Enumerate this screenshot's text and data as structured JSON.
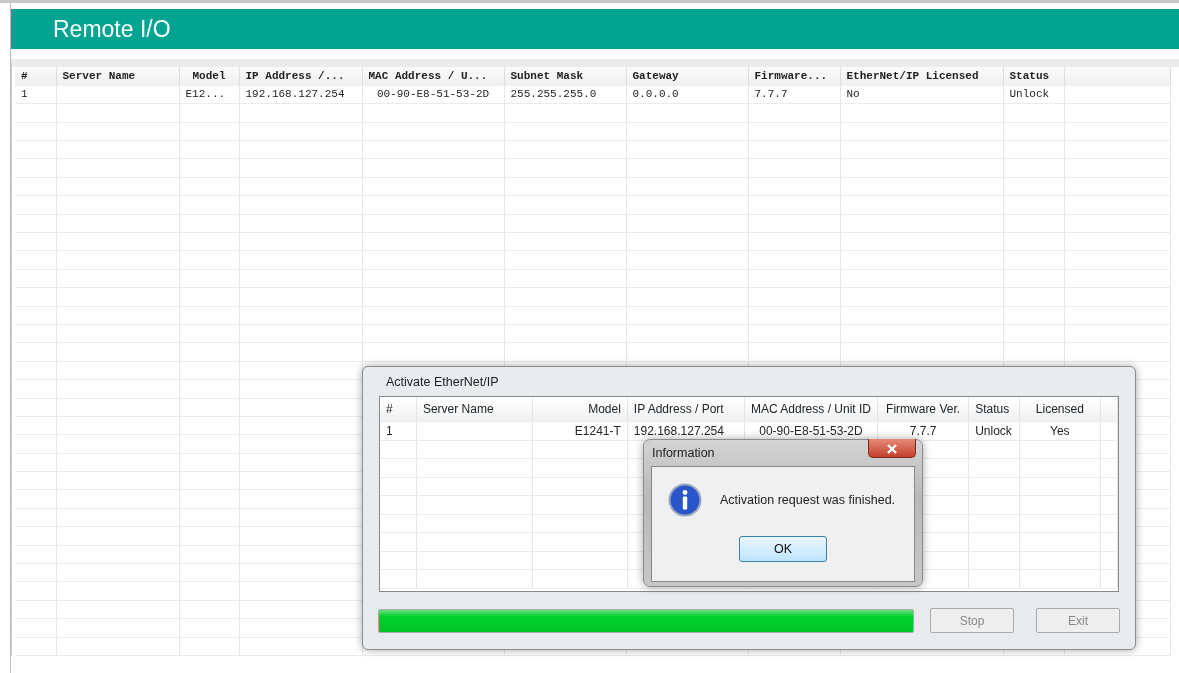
{
  "app": {
    "title": "Remote I/O"
  },
  "table": {
    "columns": [
      "#",
      "Server Name",
      "Model",
      "IP Address /...",
      "MAC Address / U...",
      "Subnet Mask",
      "Gateway",
      "Firmware...",
      "EtherNet/IP Licensed",
      "Status"
    ],
    "rows": [
      [
        "1",
        null,
        "E12...",
        "192.168.127.254",
        "00-90-E8-51-53-2D",
        "255.255.255.0",
        "0.0.0.0",
        "7.7.7",
        "No",
        "Unlock"
      ]
    ]
  },
  "activate_dialog": {
    "title": "Activate EtherNet/IP",
    "columns": [
      "#",
      "Server Name",
      "Model",
      "IP Address / Port",
      "MAC Address / Unit ID",
      "Firmware Ver.",
      "Status",
      "Licensed"
    ],
    "rows": [
      [
        "1",
        null,
        "E1241-T",
        "192.168.127.254",
        "00-90-E8-51-53-2D",
        "7.7.7",
        "Unlock",
        "Yes"
      ]
    ],
    "progress": {
      "level": 1
    },
    "buttons": [
      {
        "label": "Stop",
        "disabled": true
      },
      {
        "label": "Exit",
        "disabled": true
      }
    ]
  },
  "info_dialog": {
    "title": "Information",
    "message": "Activation request was finished.",
    "button": "OK"
  }
}
